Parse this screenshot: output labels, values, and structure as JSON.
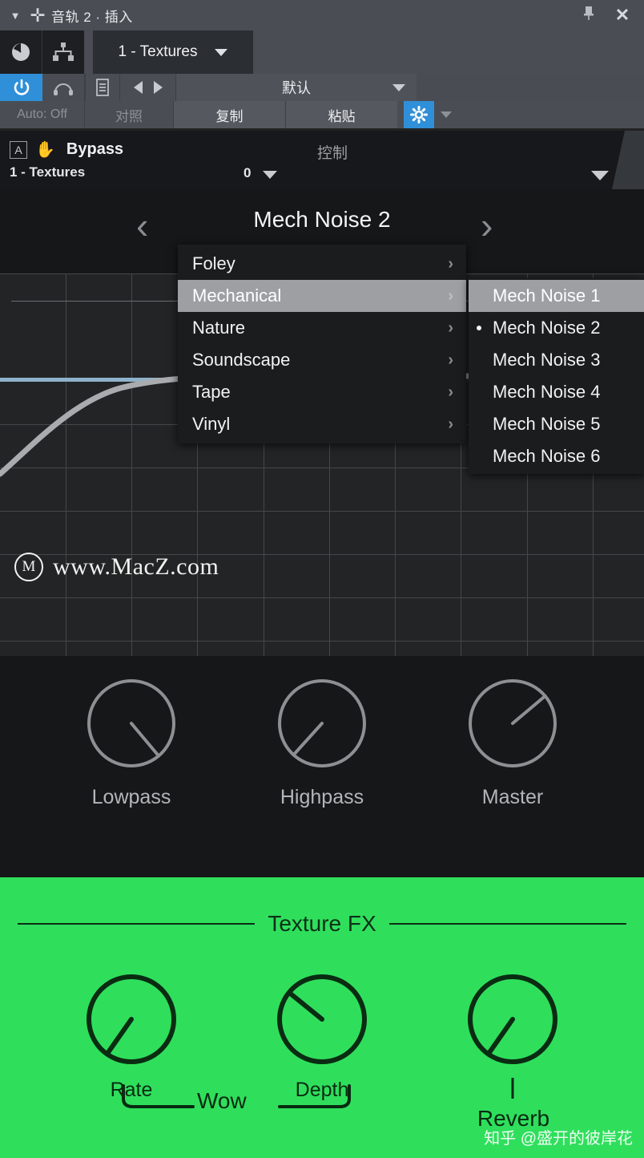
{
  "titlebar": {
    "caret_icon": "chevron-down-icon",
    "plus_icon": "plus-icon",
    "title": "音轨 2 · 插入",
    "pin_icon": "pin-icon",
    "close_icon": "close-icon"
  },
  "toolbar": {
    "knob_icon": "knob-icon",
    "routing_icon": "routing-icon",
    "slot_label": "1 - Textures",
    "power_icon": "power-icon",
    "headphone_icon": "headphone-icon",
    "doc_icon": "document-icon",
    "prev_icon": "previous-icon",
    "next_icon": "next-icon",
    "preset_name": "默认",
    "auto_label": "Auto: Off",
    "compare_label": "对照",
    "copy_label": "复制",
    "paste_label": "粘贴",
    "gear_icon": "gear-icon",
    "accent_blue": "#2f8fd8"
  },
  "plugin_header": {
    "automation_badge": "A",
    "hand_icon": "hand-icon",
    "bypass_label": "Bypass",
    "control_label": "控制",
    "slot_name": "1 - Textures",
    "value": "0"
  },
  "preset_nav": {
    "prev_icon": "chevron-left-icon",
    "next_icon": "chevron-right-icon",
    "current_preset": "Mech Noise 2"
  },
  "menu": {
    "categories": [
      {
        "label": "Foley",
        "highlighted": false
      },
      {
        "label": "Mechanical",
        "highlighted": true
      },
      {
        "label": "Nature",
        "highlighted": false
      },
      {
        "label": "Soundscape",
        "highlighted": false
      },
      {
        "label": "Tape",
        "highlighted": false
      },
      {
        "label": "Vinyl",
        "highlighted": false
      }
    ],
    "submenu": [
      {
        "label": "Mech Noise 1",
        "highlighted": true,
        "selected": false
      },
      {
        "label": "Mech Noise 2",
        "highlighted": false,
        "selected": true
      },
      {
        "label": "Mech Noise 3",
        "highlighted": false,
        "selected": false
      },
      {
        "label": "Mech Noise 4",
        "highlighted": false,
        "selected": false
      },
      {
        "label": "Mech Noise 5",
        "highlighted": false,
        "selected": false
      },
      {
        "label": "Mech Noise 6",
        "highlighted": false,
        "selected": false
      }
    ],
    "chevron_glyph": "›"
  },
  "watermark": {
    "mark": "M",
    "text": "www.MacZ.com"
  },
  "dark_knobs": [
    {
      "label": "Lowpass",
      "angle": 140
    },
    {
      "label": "Highpass",
      "angle": 222
    },
    {
      "label": "Master",
      "angle": 50
    }
  ],
  "texture_fx": {
    "title": "Texture FX",
    "knobs": [
      {
        "label": "Rate",
        "angle": 215
      },
      {
        "label": "Depth",
        "angle": 305
      },
      {
        "label": "Reverb",
        "angle": 215
      }
    ],
    "group_label": "Wow",
    "reverb_label": "Reverb",
    "background": "#2fdf5c",
    "ink": "#082a11"
  },
  "credit": "知乎 @盛开的彼岸花"
}
